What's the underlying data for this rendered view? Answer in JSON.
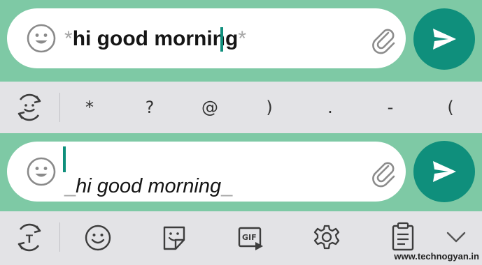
{
  "panel_top": {
    "message_text": "hi good morning",
    "bold_marker": "*"
  },
  "symbol_row": {
    "keys": [
      "*",
      "?",
      "@",
      ")",
      ".",
      "-",
      "("
    ]
  },
  "panel_bottom": {
    "message_text": "hi good morning",
    "italic_marker": "_"
  },
  "icons": {
    "emoji": "smiley-icon",
    "attach": "paperclip-icon",
    "send": "send-arrow-icon",
    "format_toggle_symbols": "rotate-emoji-icon",
    "format_toggle_text": "rotate-text-icon",
    "toolbar": [
      "emoji-icon",
      "sticker-icon",
      "gif-icon",
      "settings-icon",
      "clipboard-icon",
      "chevron-down-icon"
    ]
  },
  "toolbar_gif_label": "GIF",
  "toolbar_format_label": "T",
  "watermark": "www.technogyan.in",
  "colors": {
    "background": "#7ec9a5",
    "send_button": "#0f8f7c",
    "strip": "#e3e3e6"
  }
}
